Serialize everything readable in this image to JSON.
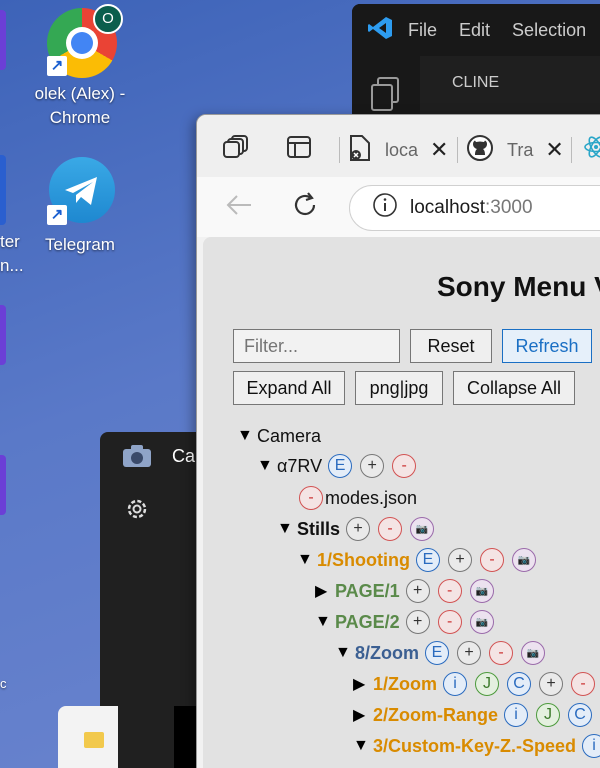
{
  "desktop": {
    "icons": [
      {
        "label1": "olek (Alex) -",
        "label2": "Chrome",
        "badge": "O",
        "icon": "chrome-icon"
      },
      {
        "label1": "Telegram",
        "label2": "",
        "icon": "telegram-icon"
      }
    ],
    "edge_text1": "ter",
    "edge_text2": "n...",
    "edge_text3": "c"
  },
  "vscode": {
    "menu": [
      "File",
      "Edit",
      "Selection"
    ],
    "panel_title": "CLINE"
  },
  "camera": {
    "title": "Ca"
  },
  "browser": {
    "tabs": [
      {
        "label": "loca",
        "icon": "document-x-icon"
      },
      {
        "label": "Tra",
        "icon": "github-icon"
      }
    ],
    "address": {
      "host": "localhost",
      "port": ":3000"
    },
    "page": {
      "title": "Sony Menu V",
      "filter_placeholder": "Filter...",
      "buttons": {
        "reset": "Reset",
        "refresh": "Refresh",
        "expand_all": "Expand All",
        "format": "png|jpg",
        "collapse_all": "Collapse All"
      },
      "tree": {
        "camera": "Camera",
        "model": "α7RV",
        "modes_file": "modes.json",
        "stills": "Stills",
        "shooting": "1/Shooting",
        "page1": "PAGE/1",
        "page2": "PAGE/2",
        "zoom_group": "8/Zoom",
        "zoom": "1/Zoom",
        "zoom_range": "2/Zoom-Range",
        "custom_key": "3/Custom-Key-Z.-Speed",
        "tag_e": "E",
        "tag_plus": "+",
        "tag_minus": "-",
        "tag_i": "i",
        "tag_j": "J",
        "tag_c": "C"
      }
    }
  },
  "colors": {
    "orange": "#d98b00",
    "green": "#5a8a4a",
    "blue": "#3b5f92",
    "refresh": "#1a6fc4"
  }
}
